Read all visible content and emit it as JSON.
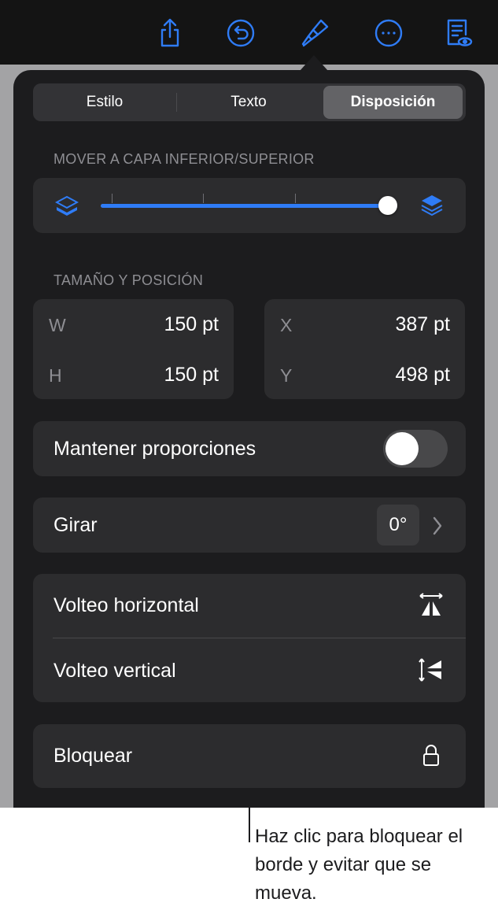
{
  "toolbar": {
    "icons": [
      "share-icon",
      "undo-icon",
      "format-brush-icon",
      "more-icon",
      "document-view-icon"
    ],
    "accent_color": "#2f7cf6"
  },
  "tabs": {
    "items": [
      "Estilo",
      "Texto",
      "Disposición"
    ],
    "selected": "Disposición"
  },
  "layer": {
    "section_title": "MOVER A CAPA INFERIOR/SUPERIOR",
    "slider_value": 1.0,
    "back_icon": "layers-back-icon",
    "front_icon": "layers-front-icon"
  },
  "size_position": {
    "section_title": "TAMAÑO Y POSICIÓN",
    "w_label": "W",
    "w_value": "150 pt",
    "h_label": "H",
    "h_value": "150 pt",
    "x_label": "X",
    "x_value": "387 pt",
    "y_label": "Y",
    "y_value": "498 pt"
  },
  "proportions": {
    "label": "Mantener proporciones",
    "enabled": false
  },
  "rotate": {
    "label": "Girar",
    "value": "0°"
  },
  "flip": {
    "horizontal_label": "Volteo horizontal",
    "vertical_label": "Volteo vertical"
  },
  "lock": {
    "label": "Bloquear"
  },
  "callout": {
    "text": "Haz clic para bloquear el borde y evitar que se mueva."
  }
}
